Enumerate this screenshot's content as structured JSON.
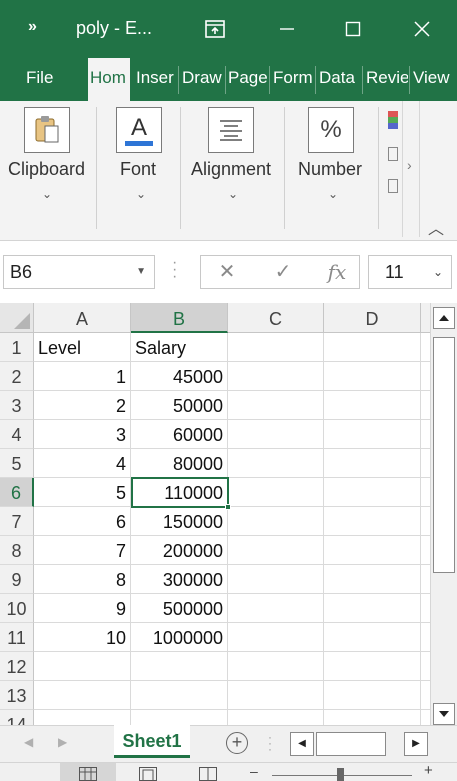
{
  "titlebar": {
    "more_icon": "»",
    "title": "poly  -  E...",
    "restore_icon": "ribbon-display-icon",
    "minimize_label": "—",
    "close_label": "✕"
  },
  "tabs": [
    "File",
    "Hom",
    "Inser",
    "Draw",
    "Page",
    "Form",
    "Data",
    "Revie",
    "View"
  ],
  "active_tab": "Hom",
  "ribbon": {
    "groups": [
      {
        "label": "Clipboard",
        "icon": "clipboard-icon"
      },
      {
        "label": "Font",
        "icon": "font-color-icon"
      },
      {
        "label": "Alignment",
        "icon": "alignment-icon"
      },
      {
        "label": "Number",
        "icon": "percent-icon"
      }
    ],
    "number_glyph": "%",
    "font_glyph": "A"
  },
  "formula_bar": {
    "name_box": "B6",
    "cancel": "✕",
    "enter": "✓",
    "fx": "fx",
    "font_size": "11"
  },
  "grid": {
    "columns": [
      "A",
      "B",
      "C",
      "D"
    ],
    "selected_column": "B",
    "rows": [
      {
        "num": "1",
        "a": "Level",
        "b": "Salary"
      },
      {
        "num": "2",
        "a": "1",
        "b": "45000"
      },
      {
        "num": "3",
        "a": "2",
        "b": "50000"
      },
      {
        "num": "4",
        "a": "3",
        "b": "60000"
      },
      {
        "num": "5",
        "a": "4",
        "b": "80000"
      },
      {
        "num": "6",
        "a": "5",
        "b": "110000"
      },
      {
        "num": "7",
        "a": "6",
        "b": "150000"
      },
      {
        "num": "8",
        "a": "7",
        "b": "200000"
      },
      {
        "num": "9",
        "a": "8",
        "b": "300000"
      },
      {
        "num": "10",
        "a": "9",
        "b": "500000"
      },
      {
        "num": "11",
        "a": "10",
        "b": "1000000"
      },
      {
        "num": "12",
        "a": "",
        "b": ""
      },
      {
        "num": "13",
        "a": "",
        "b": ""
      },
      {
        "num": "14",
        "a": "",
        "b": ""
      }
    ],
    "selected_row": "6"
  },
  "sheets": {
    "active": "Sheet1",
    "add": "+"
  },
  "colors": {
    "brand": "#217346",
    "ribbon_bg": "#f3f3f3",
    "grid_line": "#dadada"
  }
}
